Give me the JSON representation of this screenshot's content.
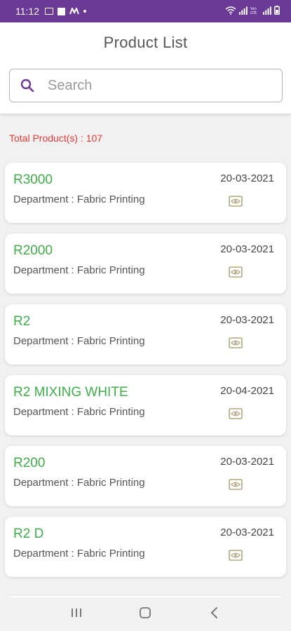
{
  "status_bar": {
    "time": "11:12",
    "background": "#6b3a96",
    "left_icons": [
      "gallery-icon",
      "square-icon",
      "m-icon",
      "dot-icon"
    ],
    "right_icons": [
      "wifi-icon",
      "signal-icon",
      "volte-icon",
      "signal-icon",
      "battery-icon"
    ]
  },
  "header": {
    "title": "Product List",
    "search_placeholder": "Search"
  },
  "total_label": "Total Product(s) : 107",
  "products": [
    {
      "name": "R3000",
      "department": "Department : Fabric Printing",
      "date": "20-03-2021"
    },
    {
      "name": "R2000",
      "department": "Department : Fabric Printing",
      "date": "20-03-2021"
    },
    {
      "name": "R2",
      "department": "Department : Fabric Printing",
      "date": "20-03-2021"
    },
    {
      "name": "R2 MIXING WHITE",
      "department": "Department : Fabric Printing",
      "date": "20-04-2021"
    },
    {
      "name": "R200",
      "department": "Department : Fabric Printing",
      "date": "20-03-2021"
    },
    {
      "name": "R2 D",
      "department": "Department : Fabric Printing",
      "date": "20-03-2021"
    }
  ],
  "colors": {
    "accent": "#6b3a96",
    "product_name": "#3fae49",
    "total": "#e53935",
    "view_icon": "#b4a580"
  },
  "nav_icons": [
    "recent-apps-icon",
    "home-icon",
    "back-icon"
  ]
}
